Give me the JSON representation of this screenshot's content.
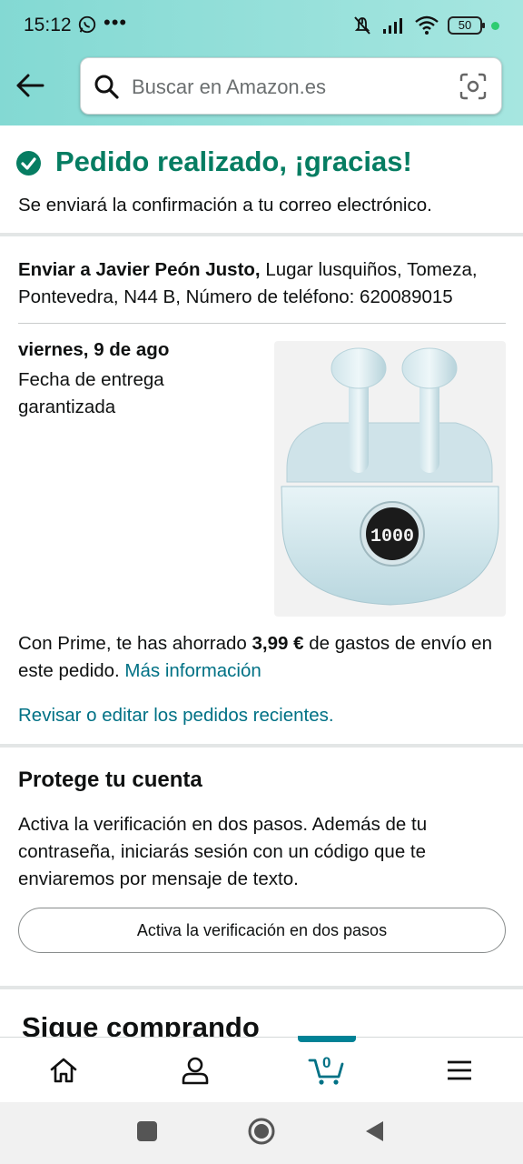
{
  "status_bar": {
    "time": "15:12",
    "battery": "50",
    "more": "•••"
  },
  "search": {
    "placeholder": "Buscar en Amazon.es"
  },
  "confirmation": {
    "title": "Pedido realizado, ¡gracias!",
    "subtitle": "Se enviará la confirmación a tu correo electrónico."
  },
  "shipping": {
    "ship_to_label": "Enviar a Javier Peón Justo,",
    "address": " Lugar lusquiños, Tomeza, Pontevedra, N44 B, Número de teléfono: 620089015",
    "delivery_date": "viernes, 9 de ago",
    "delivery_note": "Fecha de entrega garantizada",
    "product_display": "1000"
  },
  "prime": {
    "text_before": "Con Prime, te has ahorrado ",
    "amount": "3,99 €",
    "text_after": " de gastos de envío en este pedido. ",
    "more_info": "Más información"
  },
  "review_link": "Revisar o editar los pedidos recientes.",
  "protect": {
    "title": "Protege tu cuenta",
    "description": "Activa la verificación en dos pasos. Además de tu contraseña, iniciarás sesión con un código que te enviaremos por mensaje de texto.",
    "button": "Activa la verificación en dos pasos"
  },
  "keep_shopping": "Sigue comprando",
  "bottom_nav": {
    "items": [
      "home-icon",
      "account-icon",
      "cart-icon",
      "menu-icon"
    ],
    "cart_count": "0"
  },
  "colors": {
    "accent_teal": "#007185",
    "success_green": "#067d62",
    "header_bg": "#83d9d3"
  }
}
